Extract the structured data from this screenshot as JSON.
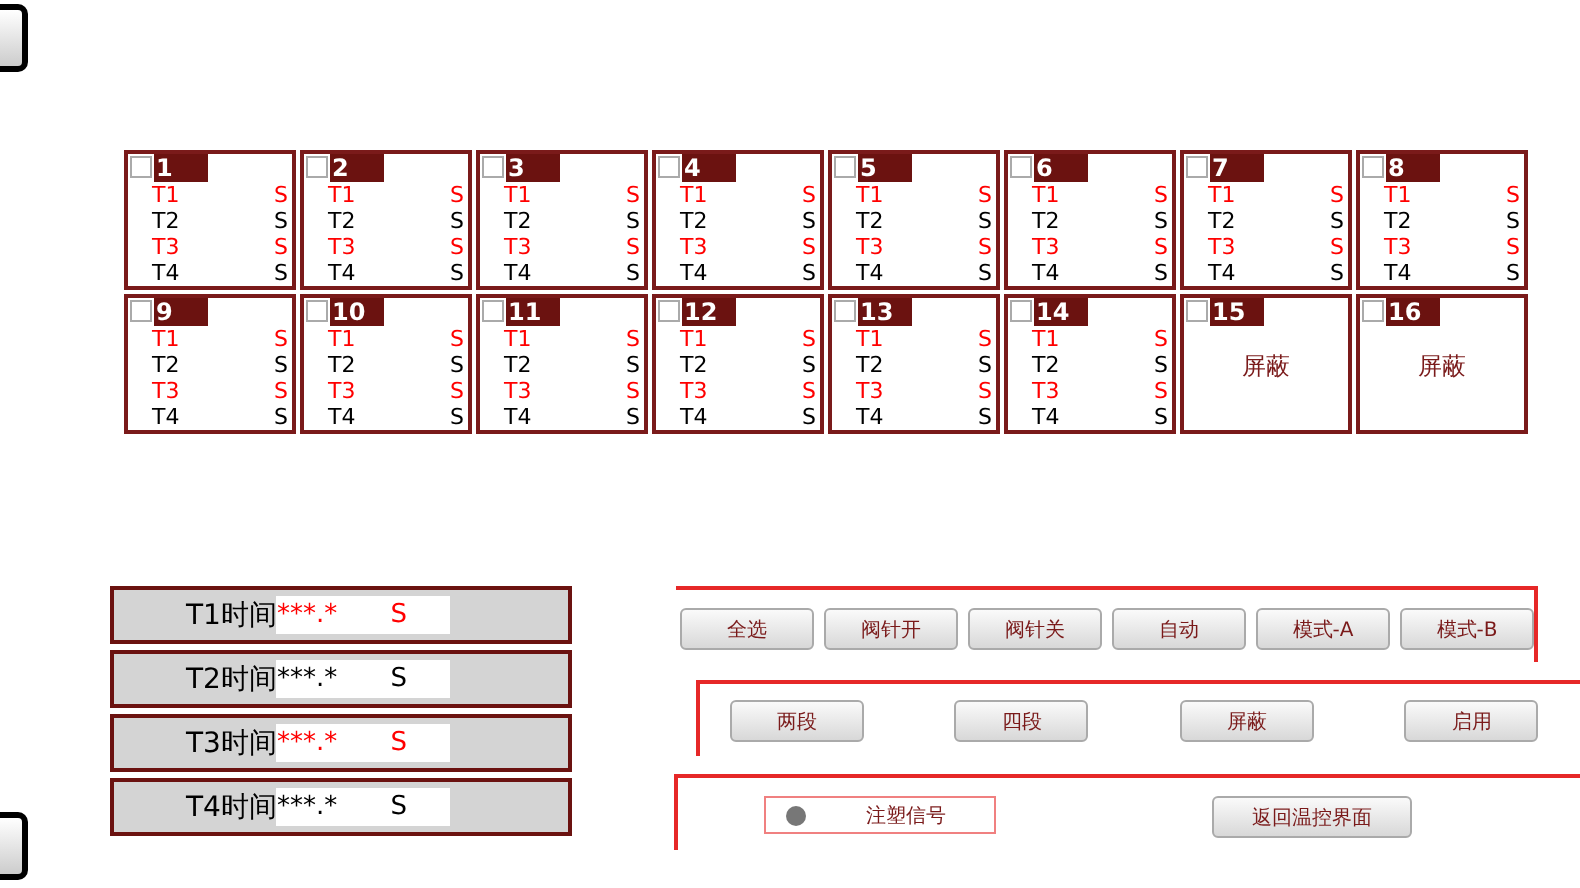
{
  "cards": [
    {
      "number": "1",
      "checked": false,
      "kind": "zones",
      "lines": [
        {
          "label": "T1",
          "unit": "S",
          "color": "#ff0000"
        },
        {
          "label": "T2",
          "unit": "S",
          "color": "#000000"
        },
        {
          "label": "T3",
          "unit": "S",
          "color": "#ff0000"
        },
        {
          "label": "T4",
          "unit": "S",
          "color": "#000000"
        }
      ]
    },
    {
      "number": "2",
      "checked": false,
      "kind": "zones",
      "lines": [
        {
          "label": "T1",
          "unit": "S",
          "color": "#ff0000"
        },
        {
          "label": "T2",
          "unit": "S",
          "color": "#000000"
        },
        {
          "label": "T3",
          "unit": "S",
          "color": "#ff0000"
        },
        {
          "label": "T4",
          "unit": "S",
          "color": "#000000"
        }
      ]
    },
    {
      "number": "3",
      "checked": false,
      "kind": "zones",
      "lines": [
        {
          "label": "T1",
          "unit": "S",
          "color": "#ff0000"
        },
        {
          "label": "T2",
          "unit": "S",
          "color": "#000000"
        },
        {
          "label": "T3",
          "unit": "S",
          "color": "#ff0000"
        },
        {
          "label": "T4",
          "unit": "S",
          "color": "#000000"
        }
      ]
    },
    {
      "number": "4",
      "checked": false,
      "kind": "zones",
      "lines": [
        {
          "label": "T1",
          "unit": "S",
          "color": "#ff0000"
        },
        {
          "label": "T2",
          "unit": "S",
          "color": "#000000"
        },
        {
          "label": "T3",
          "unit": "S",
          "color": "#ff0000"
        },
        {
          "label": "T4",
          "unit": "S",
          "color": "#000000"
        }
      ]
    },
    {
      "number": "5",
      "checked": false,
      "kind": "zones",
      "lines": [
        {
          "label": "T1",
          "unit": "S",
          "color": "#ff0000"
        },
        {
          "label": "T2",
          "unit": "S",
          "color": "#000000"
        },
        {
          "label": "T3",
          "unit": "S",
          "color": "#ff0000"
        },
        {
          "label": "T4",
          "unit": "S",
          "color": "#000000"
        }
      ]
    },
    {
      "number": "6",
      "checked": false,
      "kind": "zones",
      "lines": [
        {
          "label": "T1",
          "unit": "S",
          "color": "#ff0000"
        },
        {
          "label": "T2",
          "unit": "S",
          "color": "#000000"
        },
        {
          "label": "T3",
          "unit": "S",
          "color": "#ff0000"
        },
        {
          "label": "T4",
          "unit": "S",
          "color": "#000000"
        }
      ]
    },
    {
      "number": "7",
      "checked": false,
      "kind": "zones",
      "lines": [
        {
          "label": "T1",
          "unit": "S",
          "color": "#ff0000"
        },
        {
          "label": "T2",
          "unit": "S",
          "color": "#000000"
        },
        {
          "label": "T3",
          "unit": "S",
          "color": "#ff0000"
        },
        {
          "label": "T4",
          "unit": "S",
          "color": "#000000"
        }
      ]
    },
    {
      "number": "8",
      "checked": false,
      "kind": "zones",
      "lines": [
        {
          "label": "T1",
          "unit": "S",
          "color": "#ff0000"
        },
        {
          "label": "T2",
          "unit": "S",
          "color": "#000000"
        },
        {
          "label": "T3",
          "unit": "S",
          "color": "#ff0000"
        },
        {
          "label": "T4",
          "unit": "S",
          "color": "#000000"
        }
      ]
    },
    {
      "number": "9",
      "checked": false,
      "kind": "zones",
      "lines": [
        {
          "label": "T1",
          "unit": "S",
          "color": "#ff0000"
        },
        {
          "label": "T2",
          "unit": "S",
          "color": "#000000"
        },
        {
          "label": "T3",
          "unit": "S",
          "color": "#ff0000"
        },
        {
          "label": "T4",
          "unit": "S",
          "color": "#000000"
        }
      ]
    },
    {
      "number": "10",
      "checked": false,
      "kind": "zones",
      "lines": [
        {
          "label": "T1",
          "unit": "S",
          "color": "#ff0000"
        },
        {
          "label": "T2",
          "unit": "S",
          "color": "#000000"
        },
        {
          "label": "T3",
          "unit": "S",
          "color": "#ff0000"
        },
        {
          "label": "T4",
          "unit": "S",
          "color": "#000000"
        }
      ]
    },
    {
      "number": "11",
      "checked": false,
      "kind": "zones",
      "lines": [
        {
          "label": "T1",
          "unit": "S",
          "color": "#ff0000"
        },
        {
          "label": "T2",
          "unit": "S",
          "color": "#000000"
        },
        {
          "label": "T3",
          "unit": "S",
          "color": "#ff0000"
        },
        {
          "label": "T4",
          "unit": "S",
          "color": "#000000"
        }
      ]
    },
    {
      "number": "12",
      "checked": false,
      "kind": "zones",
      "lines": [
        {
          "label": "T1",
          "unit": "S",
          "color": "#ff0000"
        },
        {
          "label": "T2",
          "unit": "S",
          "color": "#000000"
        },
        {
          "label": "T3",
          "unit": "S",
          "color": "#ff0000"
        },
        {
          "label": "T4",
          "unit": "S",
          "color": "#000000"
        }
      ]
    },
    {
      "number": "13",
      "checked": false,
      "kind": "zones",
      "lines": [
        {
          "label": "T1",
          "unit": "S",
          "color": "#ff0000"
        },
        {
          "label": "T2",
          "unit": "S",
          "color": "#000000"
        },
        {
          "label": "T3",
          "unit": "S",
          "color": "#ff0000"
        },
        {
          "label": "T4",
          "unit": "S",
          "color": "#000000"
        }
      ]
    },
    {
      "number": "14",
      "checked": false,
      "kind": "zones",
      "lines": [
        {
          "label": "T1",
          "unit": "S",
          "color": "#ff0000"
        },
        {
          "label": "T2",
          "unit": "S",
          "color": "#000000"
        },
        {
          "label": "T3",
          "unit": "S",
          "color": "#ff0000"
        },
        {
          "label": "T4",
          "unit": "S",
          "color": "#000000"
        }
      ]
    },
    {
      "number": "15",
      "checked": false,
      "kind": "shielded",
      "status": "屏蔽"
    },
    {
      "number": "16",
      "checked": false,
      "kind": "shielded",
      "status": "屏蔽"
    }
  ],
  "times": [
    {
      "label": "T1时间",
      "value": "***.*",
      "unit": "S",
      "color": "#ff0000"
    },
    {
      "label": "T2时间",
      "value": "***.*",
      "unit": "S",
      "color": "#000000"
    },
    {
      "label": "T3时间",
      "value": "***.*",
      "unit": "S",
      "color": "#ff0000"
    },
    {
      "label": "T4时间",
      "value": "***.*",
      "unit": "S",
      "color": "#000000"
    }
  ],
  "mode_buttons": [
    "全选",
    "阀针开",
    "阀针关",
    "自动",
    "模式-A",
    "模式-B"
  ],
  "stage_buttons": [
    "两段",
    "四段",
    "屏蔽",
    "启用"
  ],
  "signal": {
    "label": "注塑信号",
    "on": false
  },
  "return_button": "返回温控界面"
}
